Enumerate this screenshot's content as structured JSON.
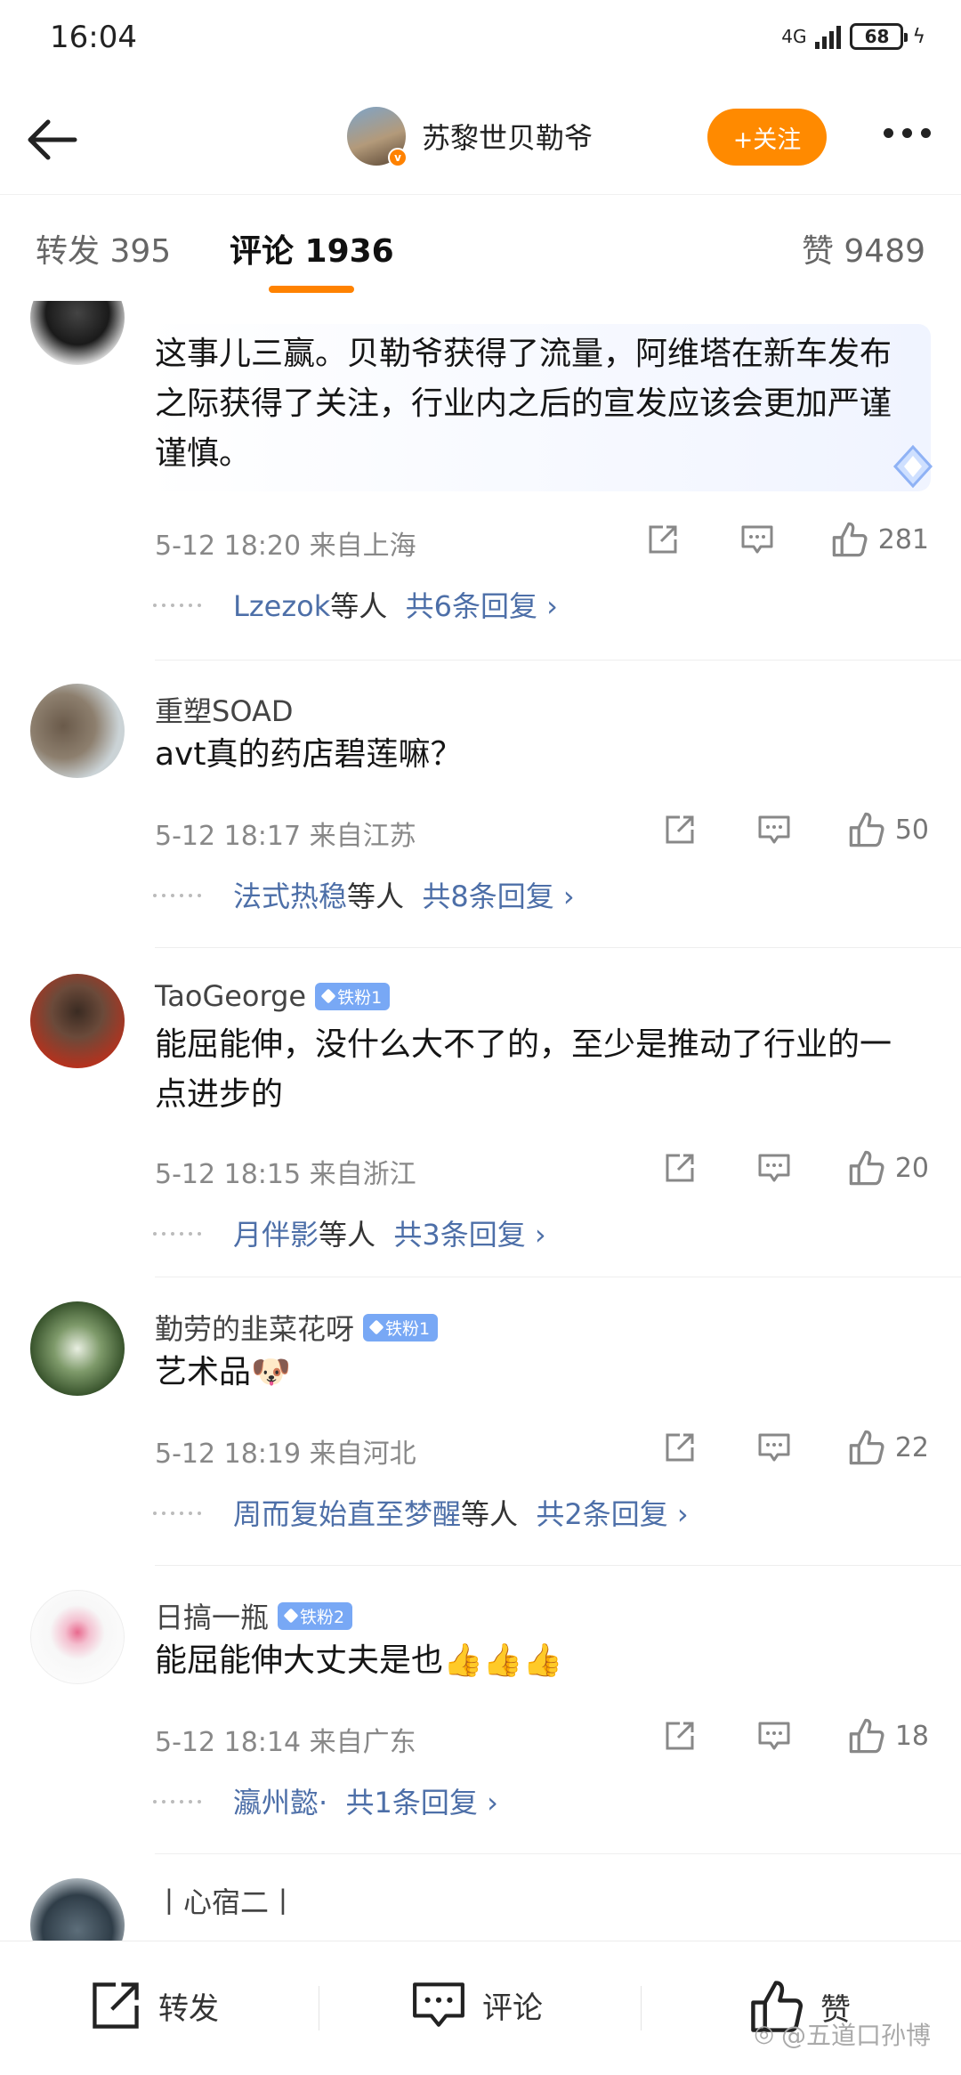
{
  "status_bar": {
    "time": "16:04",
    "network": "4G",
    "battery": "68"
  },
  "nav": {
    "title": "苏黎世贝勒爷",
    "follow_label": "+关注"
  },
  "tabs": {
    "repost": "转发 395",
    "comment": "评论 1936",
    "like": "赞 9489"
  },
  "comments": [
    {
      "user": "",
      "badge": "",
      "text": "这事儿三赢。贝勒爷获得了流量，阿维塔在新车发布之际获得了关注，行业内之后的宣发应该会更加严谨谨慎。",
      "time": "5-12 18:20 来自上海",
      "likes": "281",
      "reply_user": "Lzezok",
      "reply_suffix": "等人",
      "reply_count": "共6条回复 ›"
    },
    {
      "user": "重塑SOAD",
      "badge": "",
      "text": "avt真的药店碧莲嘛？",
      "time": "5-12 18:17 来自江苏",
      "likes": "50",
      "reply_user": "法式热稳",
      "reply_suffix": "等人",
      "reply_count": "共8条回复 ›"
    },
    {
      "user": "TaoGeorge",
      "badge": "铁粉1",
      "text": "能屈能伸，没什么大不了的，至少是推动了行业的一点进步的",
      "time": "5-12 18:15 来自浙江",
      "likes": "20",
      "reply_user": "月伴影",
      "reply_suffix": "等人",
      "reply_count": "共3条回复 ›"
    },
    {
      "user": "勤劳的韭菜花呀",
      "badge": "铁粉1",
      "text": "艺术品🐶",
      "time": "5-12 18:19 来自河北",
      "likes": "22",
      "reply_user": "周而复始直至梦醒",
      "reply_suffix": "等人",
      "reply_count": "共2条回复 ›"
    },
    {
      "user": "日搞一瓶",
      "badge": "铁粉2",
      "text": "能屈能伸大丈夫是也👍👍👍",
      "time": "5-12 18:14 来自广东",
      "likes": "18",
      "reply_user": "瀛州懿·",
      "reply_suffix": "",
      "reply_count": "共1条回复 ›"
    },
    {
      "user": "丨心宿二丨",
      "badge": "",
      "text": "",
      "time": "",
      "likes": "",
      "reply_user": "",
      "reply_suffix": "",
      "reply_count": ""
    }
  ],
  "bottom_bar": {
    "repost": "转发",
    "comment": "评论",
    "like": "赞",
    "watermark": "@五道口孙博"
  },
  "icons": [
    "back-arrow-icon",
    "more-dots-icon",
    "share-icon",
    "comment-icon",
    "thumbs-up-icon",
    "verified-icon",
    "sparkle-diamond-icon"
  ],
  "colors": {
    "accent": "#ff8200",
    "link": "#4d6fa8",
    "fan_badge": "#78a8f5"
  }
}
